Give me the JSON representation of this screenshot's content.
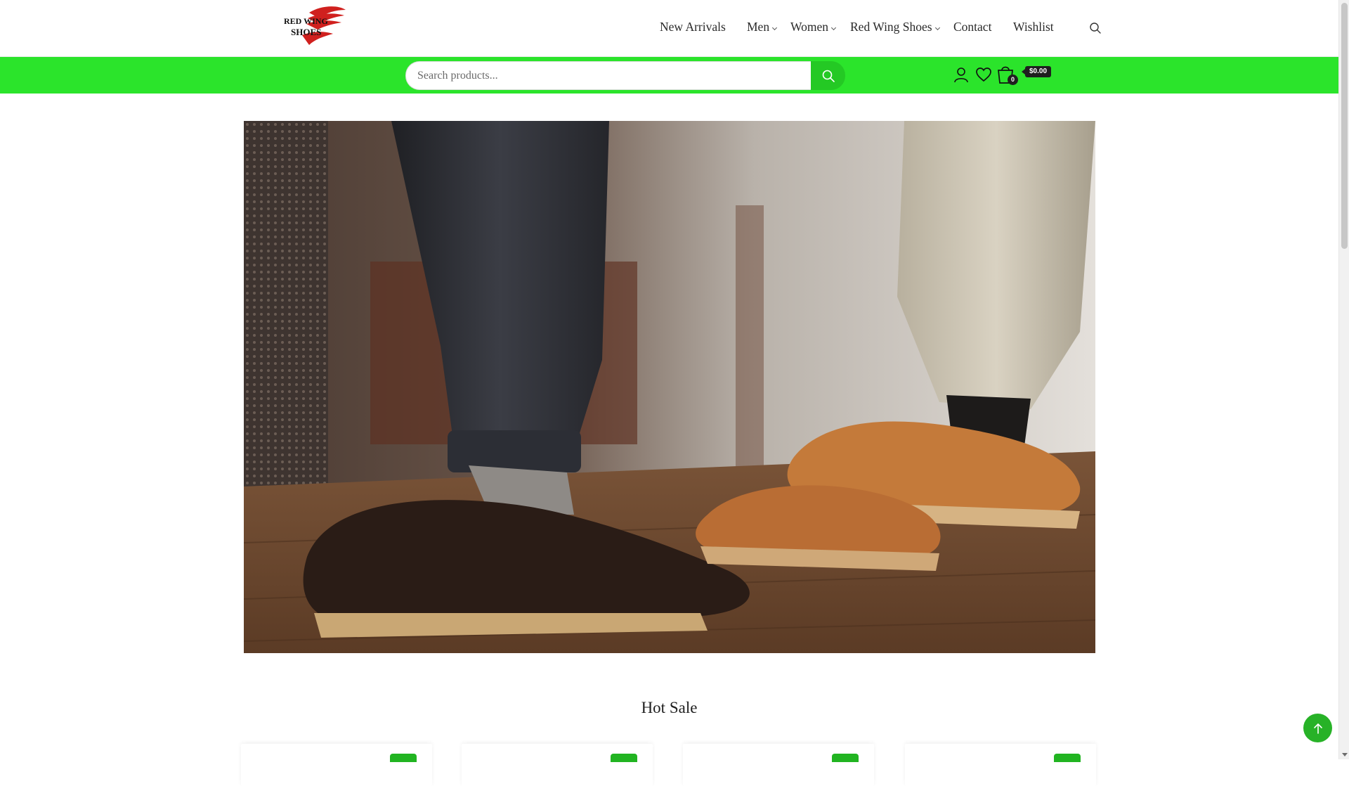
{
  "brand": {
    "logo_line1": "RED WING",
    "logo_line2": "SHOES"
  },
  "nav": {
    "items": [
      {
        "label": "New Arrivals",
        "has_dropdown": false
      },
      {
        "label": "Men",
        "has_dropdown": true
      },
      {
        "label": "Women",
        "has_dropdown": true
      },
      {
        "label": "Red Wing Shoes",
        "has_dropdown": true
      },
      {
        "label": "Contact",
        "has_dropdown": false
      },
      {
        "label": "Wishlist",
        "has_dropdown": false
      }
    ],
    "search_icon": "search-icon"
  },
  "topbar": {
    "search_placeholder": "Search products...",
    "search_value": "",
    "account_icon": "user-icon",
    "wishlist_icon": "heart-icon",
    "cart_icon": "shopping-bag-icon",
    "cart_count": "0",
    "cart_total": "$0.00"
  },
  "hero": {
    "image_subject": "two people wearing leather oxford shoes on wooden floor"
  },
  "sections": {
    "hot_sale_title": "Hot Sale"
  },
  "colors": {
    "accent_green": "#2be42b",
    "button_green": "#24c924",
    "dark": "#1f1f1f"
  },
  "back_to_top_icon": "arrow-up-icon"
}
